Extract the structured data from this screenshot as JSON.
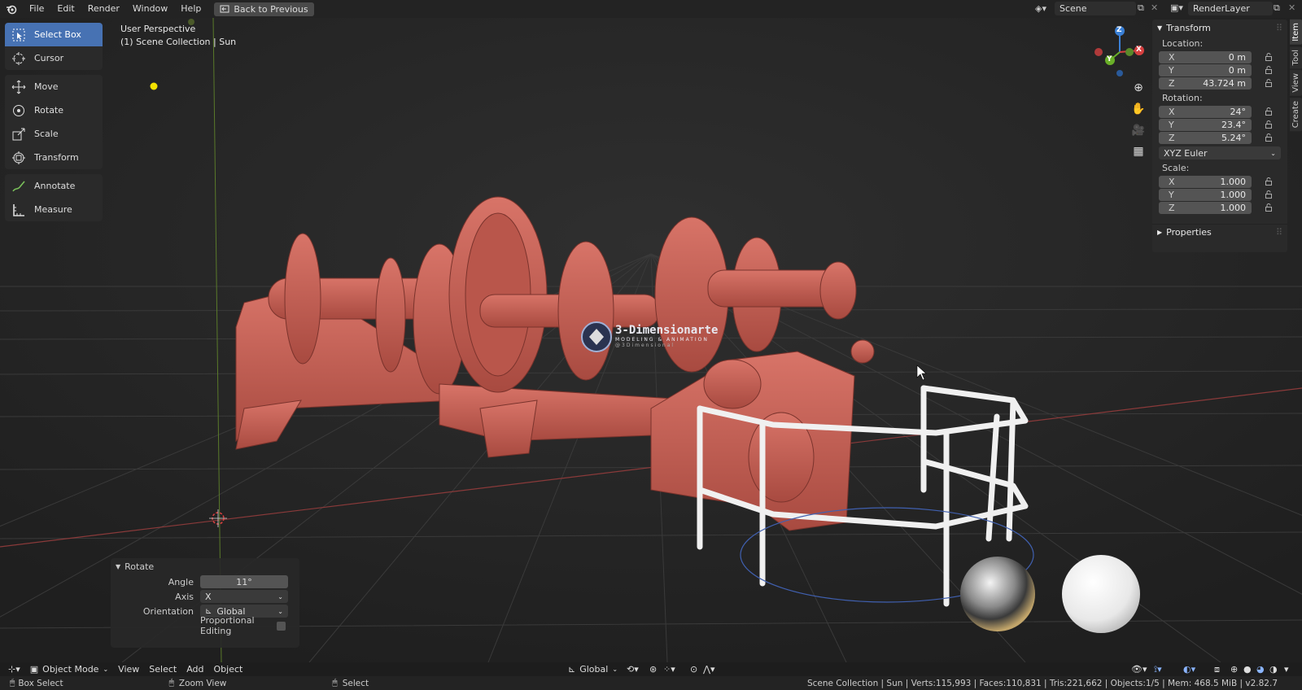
{
  "topbar": {
    "menus": [
      "File",
      "Edit",
      "Render",
      "Window",
      "Help"
    ],
    "back_button": "Back to Previous",
    "scene_name": "Scene",
    "render_layer": "RenderLayer"
  },
  "toolbar": {
    "groups": [
      [
        {
          "label": "Select Box",
          "icon": "select-box-icon",
          "active": true
        },
        {
          "label": "Cursor",
          "icon": "cursor-icon"
        }
      ],
      [
        {
          "label": "Move",
          "icon": "move-icon"
        },
        {
          "label": "Rotate",
          "icon": "rotate-icon"
        },
        {
          "label": "Scale",
          "icon": "scale-icon"
        },
        {
          "label": "Transform",
          "icon": "transform-icon"
        }
      ],
      [
        {
          "label": "Annotate",
          "icon": "annotate-icon"
        },
        {
          "label": "Measure",
          "icon": "measure-icon"
        }
      ]
    ]
  },
  "viewport": {
    "perspective_label": "User Perspective",
    "collection_label": "(1) Scene Collection | Sun",
    "watermark_title": "3-Dimensionarte",
    "watermark_sub": "MODELING & ANIMATION",
    "watermark_handle": "@3Dimensional",
    "gizmo": {
      "x": "X",
      "y": "Y",
      "z": "Z"
    }
  },
  "transform_panel": {
    "title": "Transform",
    "location_label": "Location:",
    "location": [
      {
        "axis": "X",
        "value": "0 m"
      },
      {
        "axis": "Y",
        "value": "0 m"
      },
      {
        "axis": "Z",
        "value": "43.724 m"
      }
    ],
    "rotation_label": "Rotation:",
    "rotation": [
      {
        "axis": "X",
        "value": "24°"
      },
      {
        "axis": "Y",
        "value": "23.4°"
      },
      {
        "axis": "Z",
        "value": "5.24°"
      }
    ],
    "rotation_mode": "XYZ Euler",
    "scale_label": "Scale:",
    "scale": [
      {
        "axis": "X",
        "value": "1.000"
      },
      {
        "axis": "Y",
        "value": "1.000"
      },
      {
        "axis": "Z",
        "value": "1.000"
      }
    ],
    "properties_title": "Properties"
  },
  "side_tabs": [
    "Item",
    "Tool",
    "View",
    "Create"
  ],
  "redo_panel": {
    "title": "Rotate",
    "angle_label": "Angle",
    "angle_value": "11°",
    "axis_label": "Axis",
    "axis_value": "X",
    "orientation_label": "Orientation",
    "orientation_value": "Global",
    "proportional_label": "Proportional Editing"
  },
  "header": {
    "mode": "Object Mode",
    "menus": [
      "View",
      "Select",
      "Add",
      "Object"
    ],
    "transform_orientation": "Global"
  },
  "statusbar": {
    "left_action": "Box Select",
    "middle_action": "Zoom View",
    "right_action": "Select",
    "stats": "Scene Collection | Sun | Verts:115,993 | Faces:110,831 | Tris:221,662 | Objects:1/5 | Mem: 468.5 MiB | v2.82.7"
  }
}
